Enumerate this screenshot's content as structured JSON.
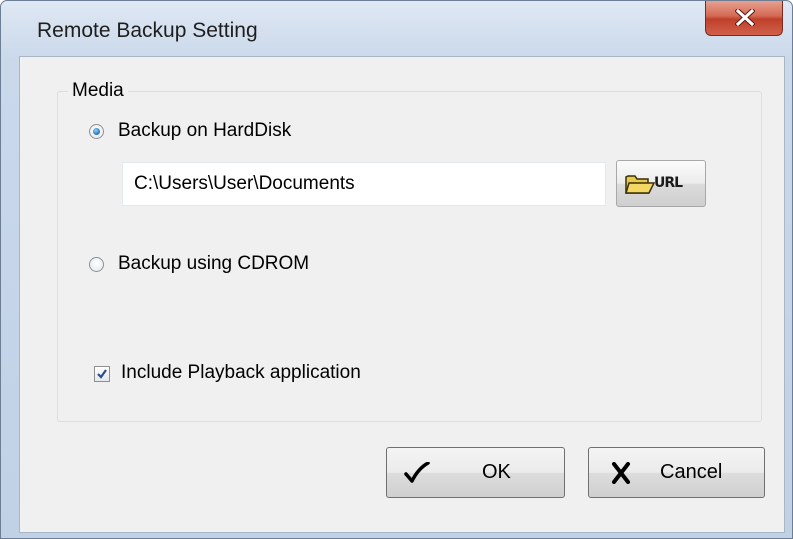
{
  "window": {
    "title": "Remote Backup Setting",
    "close_glyph": "x"
  },
  "media_group": {
    "label": "Media",
    "options": [
      {
        "label": "Backup on HardDisk",
        "selected": true
      },
      {
        "label": "Backup using CDROM",
        "selected": false
      }
    ],
    "path_value": "C:\\Users\\User\\Documents",
    "url_button_label": "URL",
    "url_button_icon": "open-folder-icon",
    "include_playback": {
      "label": "Include Playback application",
      "checked": true
    }
  },
  "buttons": {
    "ok": {
      "label": "OK",
      "icon": "checkmark-icon"
    },
    "cancel": {
      "label": "Cancel",
      "icon": "x-mark-icon"
    }
  },
  "colors": {
    "radio_selected": "#1f6fc2",
    "close_button": "#c0402a",
    "folder_icon": "#d8b23a"
  }
}
